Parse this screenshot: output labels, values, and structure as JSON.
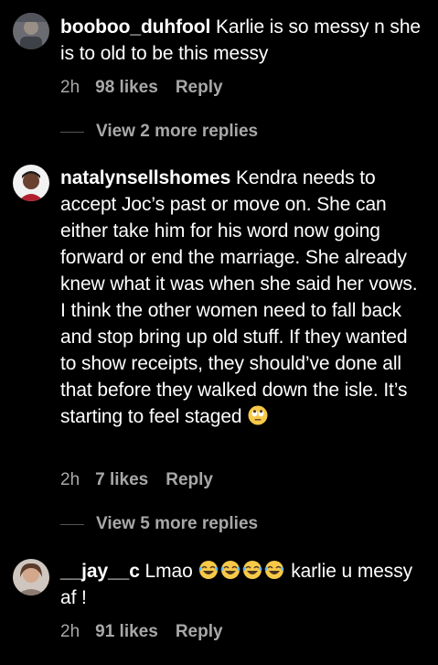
{
  "comments": [
    {
      "username": "booboo_duhfool",
      "text": "Karlie is so messy n she is to old to be this messy",
      "time": "2h",
      "likes": "98 likes",
      "reply": "Reply",
      "view_replies": "View 2 more replies"
    },
    {
      "username": "natalynsellshomes",
      "text": "Kendra needs to accept Joc’s past or move on. She can either take him for his word now going forward or end the marriage. She already knew what it was when she said her vows.  I think the other women need to fall back and stop bring up old stuff. If they wanted to show receipts, they should’ve done all that before they walked down the isle. It’s starting to feel staged",
      "time": "2h",
      "likes": "7 likes",
      "reply": "Reply",
      "view_replies": "View 5 more replies"
    },
    {
      "username": "__jay__c",
      "text_before": "Lmao",
      "text_after": "karlie u messy af !",
      "time": "2h",
      "likes": "91 likes",
      "reply": "Reply"
    }
  ],
  "colors": {
    "background": "#000000",
    "primary_text": "#ffffff",
    "secondary_text": "#a8a8a8"
  },
  "icons": [
    "eye-roll-emoji-icon",
    "tears-of-joy-emoji-icon"
  ]
}
